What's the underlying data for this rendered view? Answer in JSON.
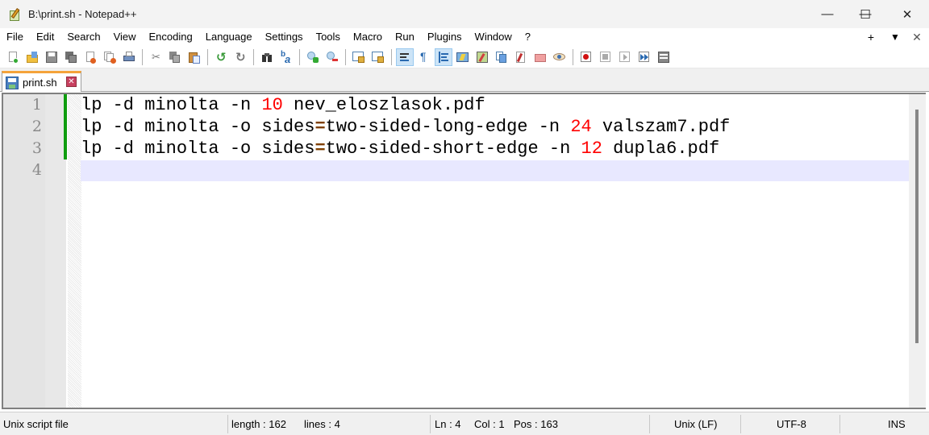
{
  "window": {
    "title": "B:\\print.sh - Notepad++",
    "controls": {
      "minimize": "—",
      "maximize": "☐",
      "close": "✕"
    }
  },
  "menubar": {
    "items": [
      "File",
      "Edit",
      "Search",
      "View",
      "Encoding",
      "Language",
      "Settings",
      "Tools",
      "Macro",
      "Run",
      "Plugins",
      "Window",
      "?"
    ],
    "right": {
      "add": "+",
      "dropdown": "▼",
      "close": "✕"
    }
  },
  "toolbar": {
    "groups": [
      [
        "new-file",
        "open-file",
        "save",
        "save-all",
        "close",
        "close-all",
        "print"
      ],
      [
        "cut",
        "copy",
        "paste"
      ],
      [
        "undo",
        "redo"
      ],
      [
        "find",
        "replace"
      ],
      [
        "zoom-in",
        "zoom-out"
      ],
      [
        "sync-vertical",
        "sync-horizontal"
      ],
      [
        "word-wrap",
        "show-all-chars",
        "indent-guide",
        "udl",
        "doc-map",
        "doc-list",
        "function-list",
        "folder-as-workspace",
        "monitoring"
      ],
      [
        "record-macro",
        "stop-recording",
        "play-macro",
        "run-macro-multiple",
        "save-macro"
      ]
    ],
    "active": [
      "word-wrap",
      "indent-guide"
    ]
  },
  "tabs": [
    {
      "label": "print.sh",
      "icon": "save-icon",
      "close": "✕",
      "active": true
    }
  ],
  "editor": {
    "current_line": 4,
    "lines": [
      {
        "no": "1",
        "tokens": [
          {
            "t": "lp -d minolta -n ",
            "c": "plain"
          },
          {
            "t": "10",
            "c": "num"
          },
          {
            "t": " nev_eloszlasok.pdf",
            "c": "plain"
          }
        ]
      },
      {
        "no": "2",
        "tokens": [
          {
            "t": "lp -d minolta -o sides",
            "c": "plain"
          },
          {
            "t": "=",
            "c": "op"
          },
          {
            "t": "two-sided-long-edge -n ",
            "c": "plain"
          },
          {
            "t": "24",
            "c": "num"
          },
          {
            "t": " valszam7.pdf",
            "c": "plain"
          }
        ]
      },
      {
        "no": "3",
        "tokens": [
          {
            "t": "lp -d minolta -o sides",
            "c": "plain"
          },
          {
            "t": "=",
            "c": "op"
          },
          {
            "t": "two-sided-short-edge -n ",
            "c": "plain"
          },
          {
            "t": "12",
            "c": "num"
          },
          {
            "t": " dupla6.pdf",
            "c": "plain"
          }
        ]
      },
      {
        "no": "4",
        "tokens": []
      }
    ]
  },
  "statusbar": {
    "filetype": "Unix script file",
    "length": "length : 162",
    "lines": "lines : 4",
    "ln": "Ln : 4",
    "col": "Col : 1",
    "pos": "Pos : 163",
    "eol": "Unix (LF)",
    "encoding": "UTF-8",
    "mode": "INS"
  },
  "colors": {
    "number": "#ff0000",
    "operator": "#804000",
    "current_line_bg": "#e8e8ff",
    "change_bar": "#0f9d0f",
    "tab_accent": "#f5a33a"
  }
}
